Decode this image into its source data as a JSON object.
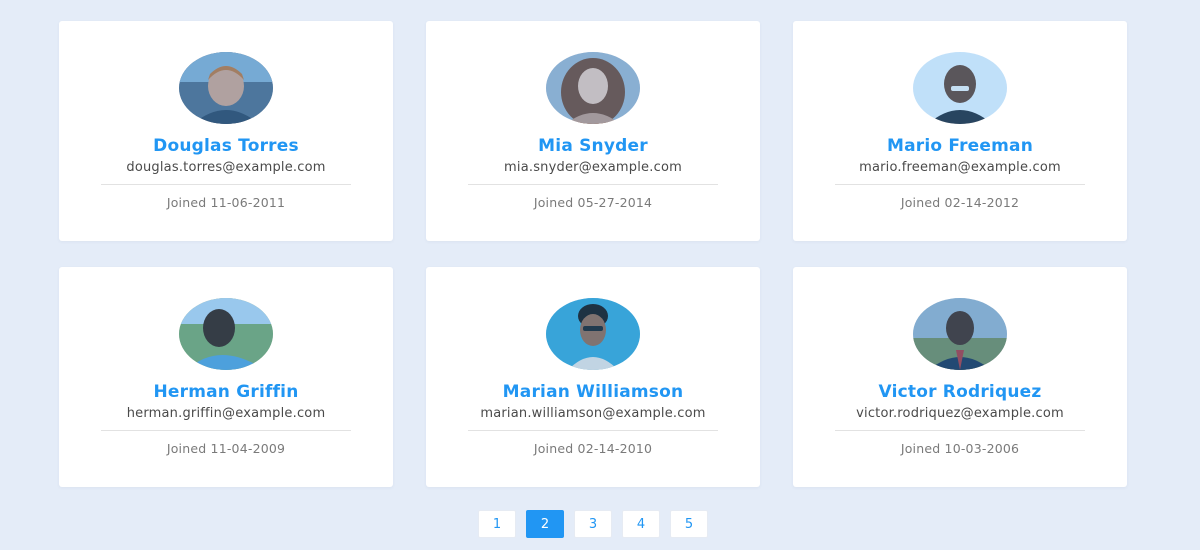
{
  "colors": {
    "accent": "#2196f3",
    "background": "#e4ecf8",
    "card": "#ffffff"
  },
  "users": [
    {
      "name": "Douglas Torres",
      "email": "douglas.torres@example.com",
      "joined": "Joined 11-06-2011",
      "avatar_icon": "user-photo-icon"
    },
    {
      "name": "Mia Snyder",
      "email": "mia.snyder@example.com",
      "joined": "Joined 05-27-2014",
      "avatar_icon": "user-photo-icon"
    },
    {
      "name": "Mario Freeman",
      "email": "mario.freeman@example.com",
      "joined": "Joined 02-14-2012",
      "avatar_icon": "user-photo-icon"
    },
    {
      "name": "Herman Griffin",
      "email": "herman.griffin@example.com",
      "joined": "Joined 11-04-2009",
      "avatar_icon": "user-photo-icon"
    },
    {
      "name": "Marian Williamson",
      "email": "marian.williamson@example.com",
      "joined": "Joined 02-14-2010",
      "avatar_icon": "user-photo-icon"
    },
    {
      "name": "Victor Rodriquez",
      "email": "victor.rodriquez@example.com",
      "joined": "Joined 10-03-2006",
      "avatar_icon": "user-photo-icon"
    }
  ],
  "pagination": {
    "pages": [
      "1",
      "2",
      "3",
      "4",
      "5"
    ],
    "current": "2"
  }
}
